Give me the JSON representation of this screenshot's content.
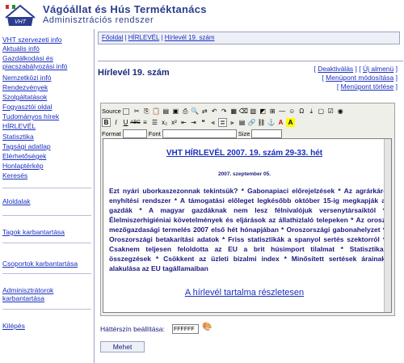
{
  "header": {
    "title": "Vágóállat és Hús Terméktanács",
    "subtitle": "Adminisztrációs rendszer",
    "logo_text": "VHT"
  },
  "sidebar": {
    "items": [
      "VHT szervezeti info",
      "Aktuális infó",
      "Gazdálkodási és",
      "piacszabályozási infó",
      "Nemzetközi infó",
      "Rendezvények",
      "Szolgáltatások",
      "Fogyasztói oldal",
      "Tudományos hírek",
      "HÍRLEVÉL",
      "Statisztika",
      "Tagsági adatlap",
      "Elérhetőségek",
      "Honlaptérkép",
      "Keresés"
    ],
    "aloldalak": "Aloldalak",
    "tagok": "Tagok karbantartása",
    "csoportok": "Csoportok karbantartása",
    "admin1": "Adminisztrátorok",
    "admin2": "karbantartása",
    "kilepes": "Kilépés"
  },
  "breadcrumb": [
    "Főoldal",
    "HÍRLEVÉL",
    "Hírlevél 19. szám"
  ],
  "page_title": "Hírlevél 19. szám",
  "actions": {
    "deactivate": "Deaktiválás",
    "new_menu": "Új almenü",
    "modify": "Menüpont módosítása",
    "delete": "Menüpont törlése"
  },
  "editor": {
    "source": "Source",
    "format_label": "Format",
    "font_label": "Font",
    "size_label": "Size",
    "nl_title": "VHT HÍRLEVÉL 2007. 19. szám 29-33. hét",
    "nl_date": "2007. szeptember 05.",
    "nl_body": "Ezt nyári uborkaszezonnak tekintsük? * Gabonapiaci előrejelzések * Az agrárkár-enyhítési rendszer * A támogatási előleget legkésőbb október 15-ig megkapják a gazdák * A magyar gazdáknak nem lesz félnivalójuk versenytársaiktól * Élelmiszerhigiéniai követelmények és eljárások az állathizlaló telepeken * Az orosz mezőgazdasági termelés 2007 első hét hónapjában * Oroszországi gabonahelyzet * Oroszországi betakarítási adatok * Friss statisztikák a spanyol sertés szektorról * Csaknem teljesen feloldotta az EU a brit húsimport tilalmat * Statisztikai összegzések * Csökkent az üzleti bizalmi index * Minősített sertések árainak alakulása az EU tagállamaiban",
    "nl_link": "A hírlevél tartalma részletesen"
  },
  "bg": {
    "label": "Háttérszín beállítása:",
    "value": "FFFFFF"
  },
  "submit": "Mehet"
}
